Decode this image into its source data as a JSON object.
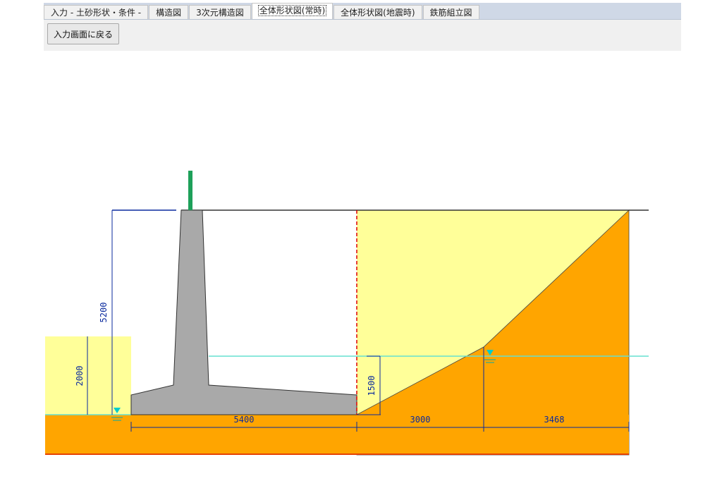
{
  "tabs": [
    {
      "label": "入力 - 土砂形状・条件 -",
      "active": false
    },
    {
      "label": "構造図",
      "active": false
    },
    {
      "label": "3次元構造図",
      "active": false
    },
    {
      "label": "全体形状図(常時)",
      "active": true
    },
    {
      "label": "全体形状図(地震時)",
      "active": false
    },
    {
      "label": "鉄筋組立図",
      "active": false
    }
  ],
  "toolbar": {
    "back_label": "入力画面に戻る"
  },
  "drawing": {
    "dim_wall_height": "5200",
    "dim_front_water": "2000",
    "dim_back_water": "1500",
    "dim_heel_length": "5400",
    "dim_slope_lower": "3000",
    "dim_slope_upper": "3468"
  },
  "colors": {
    "backfill": "#ffff99",
    "soil": "#ffa500",
    "concrete": "#a9a9a9",
    "dimension": "#0a2a9e",
    "water_line": "#66e0d0",
    "handrail": "#1ea05a",
    "section_line": "#dd0000"
  }
}
